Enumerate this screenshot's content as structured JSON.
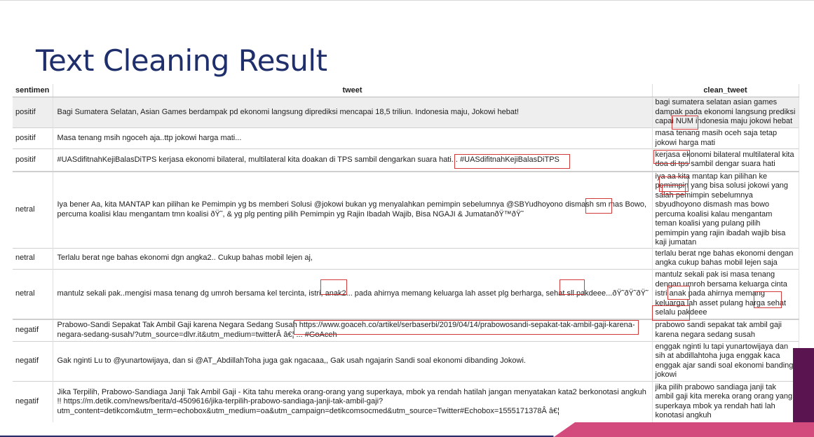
{
  "slide": {
    "title": "Text Cleaning Result"
  },
  "table": {
    "headers": [
      "sentimen",
      "tweet",
      "clean_tweet"
    ],
    "rows": [
      {
        "sentimen": "positif",
        "tweet": "Bagi Sumatera Selatan, Asian Games berdampak pd ekonomi langsung diprediksi mencapai 18,5 triliun. Indonesia maju, Jokowi hebat!",
        "clean_tweet": "bagi sumatera selatan asian games dampak pada ekonomi langsung prediksi capai NUM indonesia maju jokowi hebat"
      },
      {
        "sentimen": "positif",
        "tweet": "Masa tenang msih ngoceh aja..ttp jokowi harga mati...",
        "clean_tweet": "masa tenang masih oceh saja tetap jokowi harga mati"
      },
      {
        "sentimen": "positif",
        "tweet": "#UASdifitnahKejiBalasDiTPS kerjasa ekonomi bilateral, multilateral kita doakan di TPS sambil dengarkan suara hati... #UASdifitnahKejiBalasDiTPS",
        "clean_tweet": "kerjasa ekonomi bilateral multilateral kita doa di tps sambil dengar suara hati"
      },
      {
        "sentimen": "netral",
        "tweet": "Iya bener Aa, kita MANTAP kan pilihan ke Pemimpin yg bs memberi Solusi @jokowi bukan yg menyalahkan pemimpin sebelumnya @SBYudhoyono dismash sm mas Bowo, percuma koalisi klau mengantam tmn koalisi ðŸ˜, & yg plg penting pilih Pemimpin yg Rajin Ibadah Wajib, Bisa NGAJI & JumatanðŸ™ðŸ˜",
        "clean_tweet": "iya aa kita mantap kan pilihan ke pemimpin yang bisa solusi jokowi yang salah pemimpin sebelumnya sbyudhoyono dismash mas bowo percuma koalisi kalau mengantam teman koalisi yang pulang pilih pemimpin yang rajin ibadah wajib bisa kaji jumatan"
      },
      {
        "sentimen": "netral",
        "tweet": "Terlalu berat nge bahas ekonomi dgn angka2.. Cukup bahas mobil lejen aj,",
        "clean_tweet": "terlalu berat nge bahas ekonomi dengan angka cukup bahas mobil lejen saja"
      },
      {
        "sentimen": "netral",
        "tweet": "mantulz sekali pak..mengisi masa tenang dg umroh bersama kel tercinta, istri, anak2... pada ahirnya memang keluarga lah asset plg berharga, sehat sll pakdeee...ðŸ˜ðŸ˜ðŸ˜",
        "clean_tweet": "mantulz sekali pak isi masa tenang dengan umroh bersama keluarga cinta istri anak pada ahirnya memang keluarga lah asset pulang harga sehat selalu pakdeee"
      },
      {
        "sentimen": "negatif",
        "tweet": "Prabowo-Sandi Sepakat Tak Ambil Gaji karena Negara Sedang Susah https://www.goaceh.co/artikel/serbaserbi/2019/04/14/prabowosandi-sepakat-tak-ambil-gaji-karena-negara-sedang-susah/?utm_source=dlvr.it&utm_medium=twitterÂ â€¦ ... #GoAceh",
        "clean_tweet": "prabowo sandi sepakat tak ambil gaji karena negara sedang susah"
      },
      {
        "sentimen": "negatif",
        "tweet": "Gak nginti Lu to @yunartowijaya, dan si @AT_AbdillahToha juga gak ngacaaa,, Gak usah ngajarin Sandi soal ekonomi dibanding Jokowi.",
        "clean_tweet": "enggak nginti lu tapi yunartowijaya dan sih at abdillahtoha juga enggak kaca enggak ajar sandi soal ekonomi banding jokowi"
      },
      {
        "sentimen": "negatif",
        "tweet": "Jika Terpilih, Prabowo-Sandiaga Janji Tak Ambil Gaji - Kita tahu mereka orang-orang yang superkaya, mbok ya rendah hatilah jangan menyatakan kata2 berkonotasi angkuh !! https://m.detik.com/news/berita/d-4509616/jika-terpilih-prabowo-sandiaga-janji-tak-ambil-gaji?utm_content=detikcom&utm_term=echobox&utm_medium=oa&utm_campaign=detikcomsocmed&utm_source=Twitter#Echobox=1555171378Â â€¦",
        "clean_tweet": "jika pilih prabowo sandiaga janji tak ambil gaji kita mereka orang orang yang superkaya mbok ya rendah hati lah konotasi angkuh"
      }
    ]
  }
}
